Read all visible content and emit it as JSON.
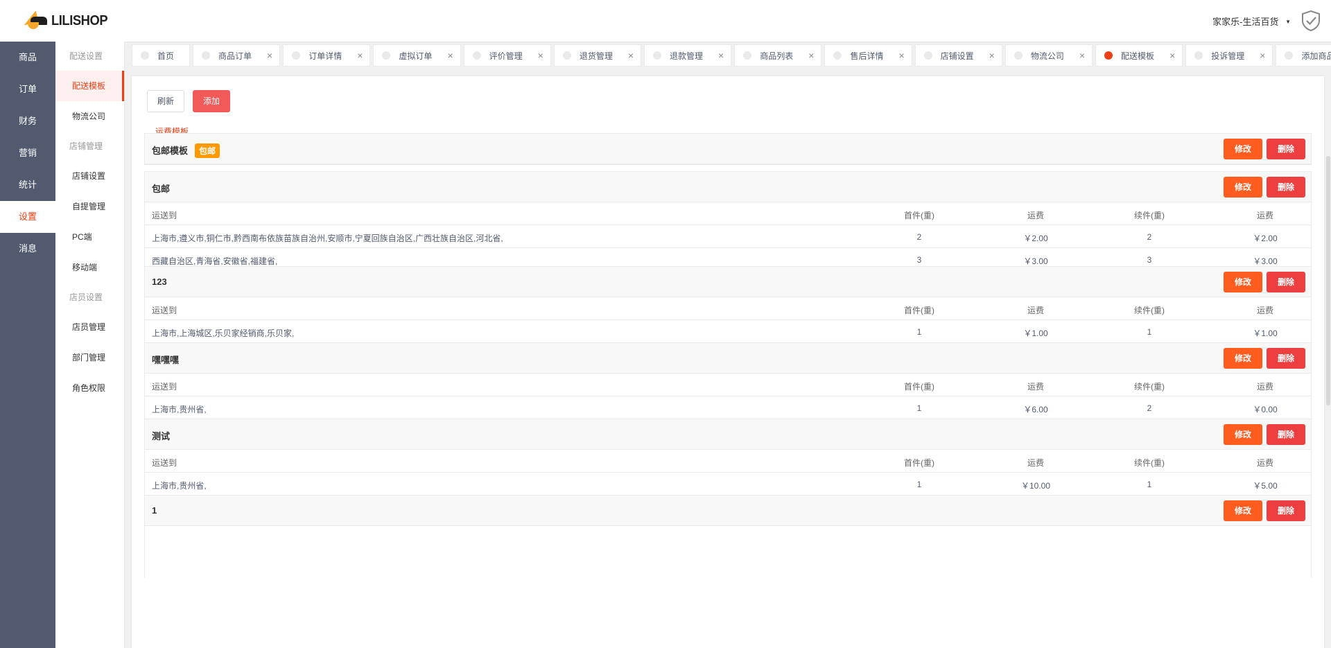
{
  "brand": {
    "name": "LILISHOP"
  },
  "nav_primary": [
    "商品",
    "订单",
    "财务",
    "营销",
    "统计",
    "设置",
    "消息"
  ],
  "nav_secondary": [
    {
      "type": "group",
      "label": "配送设置"
    },
    {
      "type": "item",
      "label": "配送模板",
      "active": true
    },
    {
      "type": "item",
      "label": "物流公司"
    },
    {
      "type": "group",
      "label": "店铺管理"
    },
    {
      "type": "item",
      "label": "店铺设置"
    },
    {
      "type": "item",
      "label": "自提管理"
    },
    {
      "type": "item",
      "label": "PC端"
    },
    {
      "type": "item",
      "label": "移动端"
    },
    {
      "type": "group",
      "label": "店员设置"
    },
    {
      "type": "item",
      "label": "店员管理"
    },
    {
      "type": "item",
      "label": "部门管理"
    },
    {
      "type": "item",
      "label": "角色权限"
    }
  ],
  "header": {
    "store": "家家乐-生活百货"
  },
  "tabs": [
    {
      "label": "首页",
      "closable": false
    },
    {
      "label": "商品订单",
      "closable": true
    },
    {
      "label": "订单详情",
      "closable": true
    },
    {
      "label": "虚拟订单",
      "closable": true
    },
    {
      "label": "评价管理",
      "closable": true
    },
    {
      "label": "退货管理",
      "closable": true
    },
    {
      "label": "退款管理",
      "closable": true
    },
    {
      "label": "商品列表",
      "closable": true
    },
    {
      "label": "售后详情",
      "closable": true
    },
    {
      "label": "店铺设置",
      "closable": true
    },
    {
      "label": "物流公司",
      "closable": true
    },
    {
      "label": "配送模板",
      "closable": true,
      "active": true
    },
    {
      "label": "投诉管理",
      "closable": true
    },
    {
      "label": "添加商品",
      "closable": true
    }
  ],
  "toolbar": {
    "refresh": "刷新",
    "add": "添加"
  },
  "subtab": "运费模板",
  "actions": {
    "edit": "修改",
    "delete": "删除"
  },
  "columns": [
    "运送到",
    "首件(重)",
    "运费",
    "续件(重)",
    "运费"
  ],
  "templates": [
    {
      "name": "包邮模板",
      "badge": "包邮",
      "rows": []
    },
    {
      "name": "包邮",
      "rows": [
        [
          "上海市,遵义市,铜仁市,黔西南布依族苗族自治州,安顺市,宁夏回族自治区,广西壮族自治区,河北省,",
          "2",
          "￥2.00",
          "2",
          "￥2.00"
        ],
        [
          "西藏自治区,青海省,安徽省,福建省,",
          "3",
          "￥3.00",
          "3",
          "￥3.00"
        ]
      ]
    },
    {
      "name": "123",
      "rows": [
        [
          "上海市,上海城区,乐贝家经销商,乐贝家,",
          "1",
          "￥1.00",
          "1",
          "￥1.00"
        ]
      ]
    },
    {
      "name": "嘿嘿嘿",
      "rows": [
        [
          "上海市,贵州省,",
          "1",
          "￥6.00",
          "2",
          "￥0.00"
        ]
      ]
    },
    {
      "name": "测试",
      "rows": [
        [
          "上海市,贵州省,",
          "1",
          "￥10.00",
          "1",
          "￥5.00"
        ]
      ]
    },
    {
      "name": "1",
      "rows": []
    }
  ]
}
